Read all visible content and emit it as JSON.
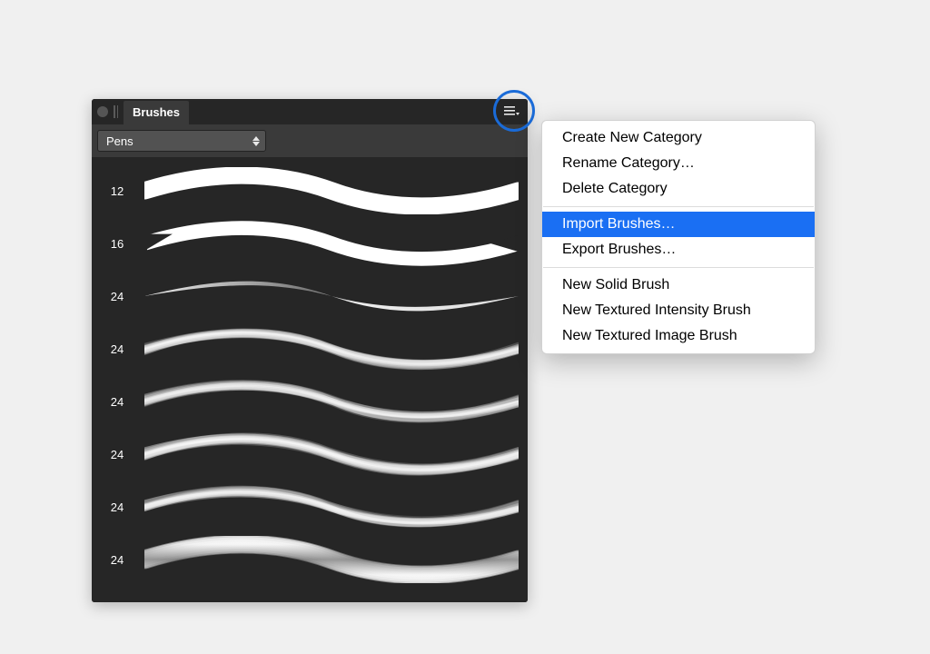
{
  "panel": {
    "tab_title": "Brushes",
    "category_label": "Pens",
    "brushes": [
      {
        "size": "12",
        "style": "smooth_thick"
      },
      {
        "size": "16",
        "style": "smooth_taper"
      },
      {
        "size": "24",
        "style": "gradient_bulge"
      },
      {
        "size": "24",
        "style": "texture_a"
      },
      {
        "size": "24",
        "style": "texture_b"
      },
      {
        "size": "24",
        "style": "texture_c"
      },
      {
        "size": "24",
        "style": "texture_d"
      },
      {
        "size": "24",
        "style": "gradient_taper"
      }
    ]
  },
  "context_menu": {
    "groups": [
      [
        {
          "label": "Create New Category"
        },
        {
          "label": "Rename Category…"
        },
        {
          "label": "Delete Category"
        }
      ],
      [
        {
          "label": "Import Brushes…",
          "highlight": true
        },
        {
          "label": "Export Brushes…"
        }
      ],
      [
        {
          "label": "New Solid Brush"
        },
        {
          "label": "New Textured Intensity Brush"
        },
        {
          "label": "New Textured Image Brush"
        }
      ]
    ]
  },
  "annotations": {
    "panel_menu_circle": true
  },
  "colors": {
    "highlight_blue": "#1a6ff3",
    "annotation_blue": "#1a6bd8",
    "panel_dark": "#262626"
  }
}
